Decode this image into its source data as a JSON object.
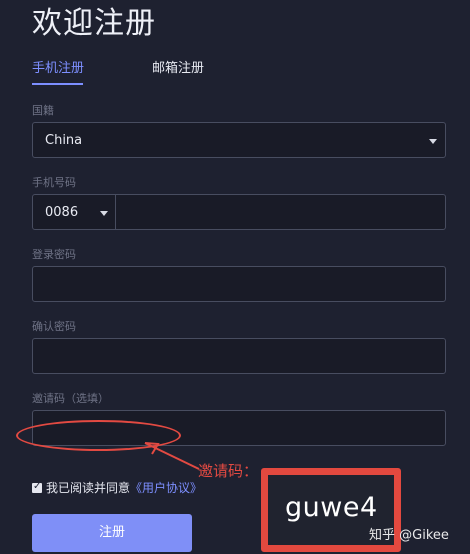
{
  "page": {
    "title": "欢迎注册"
  },
  "tabs": [
    {
      "label": "手机注册",
      "active": true
    },
    {
      "label": "邮箱注册",
      "active": false
    }
  ],
  "form": {
    "country": {
      "label": "国籍",
      "value": "China"
    },
    "phone": {
      "label": "手机号码",
      "code": "0086",
      "value": ""
    },
    "password": {
      "label": "登录密码",
      "value": ""
    },
    "confirm_password": {
      "label": "确认密码",
      "value": ""
    },
    "invite_code": {
      "label": "邀请码（选填）",
      "value": ""
    },
    "agreement": {
      "prefix": "我已阅读并同意",
      "link": "《用户协议》",
      "checked": true
    },
    "submit_label": "注册"
  },
  "annotation": {
    "label": "邀请码：",
    "code": "guwe4",
    "color": "#e34a42"
  },
  "watermark": "知乎 @Gikee",
  "colors": {
    "background": "#1e2130",
    "accent": "#7d8fff",
    "field_border": "#484d60",
    "button": "#7f8ff7",
    "annotation": "#e34a42"
  }
}
